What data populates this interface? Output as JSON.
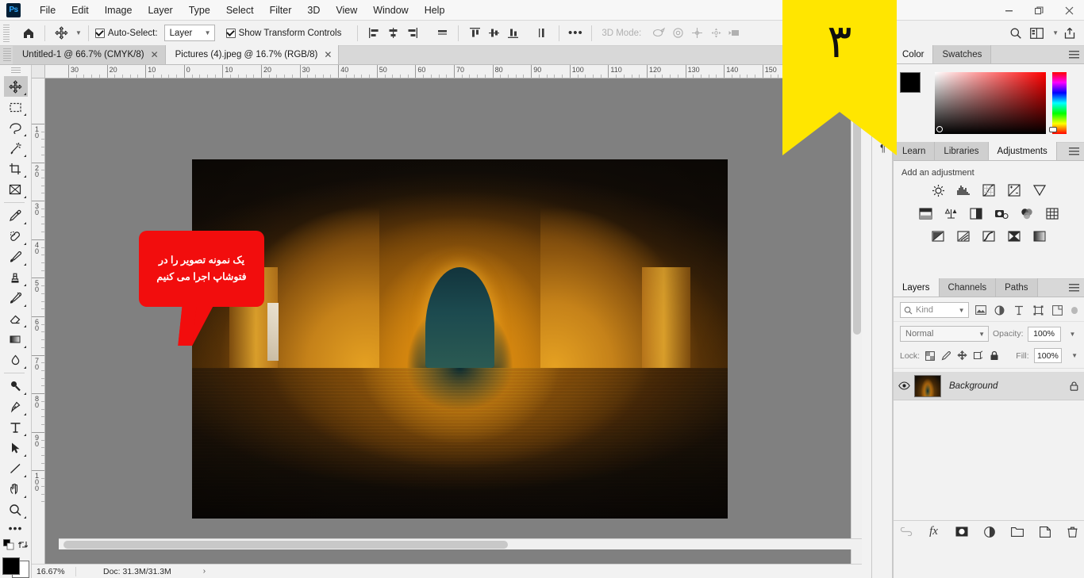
{
  "app": {
    "logo_text": "Ps",
    "menus": [
      "File",
      "Edit",
      "Image",
      "Layer",
      "Type",
      "Select",
      "Filter",
      "3D",
      "View",
      "Window",
      "Help"
    ],
    "window_controls": {
      "minimize": "—",
      "restore": "❐",
      "close": "✕"
    }
  },
  "options_bar": {
    "home_icon": "home-icon",
    "tool_icon": "move-tool-icon",
    "auto_select_label": "Auto-Select:",
    "auto_select_checked": true,
    "auto_select_value": "Layer",
    "show_transform_label": "Show Transform Controls",
    "show_transform_checked": true,
    "more_label": "•••",
    "three_d_mode_label": "3D Mode:",
    "right_icons": [
      "search-icon",
      "workspace-icon",
      "share-icon"
    ]
  },
  "tabs": [
    {
      "title": "Untitled-1 @ 66.7% (CMYK/8)",
      "active": false,
      "close": "✕"
    },
    {
      "title": "Pictures (4).jpeg @ 16.7% (RGB/8)",
      "active": true,
      "close": "✕"
    }
  ],
  "toolbar": {
    "tools": [
      {
        "name": "move-tool",
        "glyph": "move",
        "active": true
      },
      {
        "name": "marquee-tool",
        "glyph": "marquee",
        "active": false
      },
      {
        "name": "lasso-tool",
        "glyph": "lasso",
        "active": false
      },
      {
        "name": "magic-wand-tool",
        "glyph": "wand",
        "active": false
      },
      {
        "name": "crop-tool",
        "glyph": "crop",
        "active": false
      },
      {
        "name": "frame-tool",
        "glyph": "frame",
        "active": false
      },
      {
        "name": "eyedropper-tool",
        "glyph": "eyedropper",
        "active": false
      },
      {
        "name": "healing-brush-tool",
        "glyph": "healing",
        "active": false
      },
      {
        "name": "brush-tool",
        "glyph": "brush",
        "active": false
      },
      {
        "name": "clone-stamp-tool",
        "glyph": "stamp",
        "active": false
      },
      {
        "name": "history-brush-tool",
        "glyph": "history",
        "active": false
      },
      {
        "name": "eraser-tool",
        "glyph": "eraser",
        "active": false
      },
      {
        "name": "gradient-tool",
        "glyph": "gradient",
        "active": false
      },
      {
        "name": "blur-tool",
        "glyph": "blur",
        "active": false
      },
      {
        "name": "dodge-tool",
        "glyph": "dodge",
        "active": false
      },
      {
        "name": "pen-tool",
        "glyph": "pen",
        "active": false
      },
      {
        "name": "type-tool",
        "glyph": "type",
        "active": false
      },
      {
        "name": "path-selection-tool",
        "glyph": "arrow",
        "active": false
      },
      {
        "name": "line-tool",
        "glyph": "line",
        "active": false
      },
      {
        "name": "hand-tool",
        "glyph": "hand",
        "active": false
      },
      {
        "name": "zoom-tool",
        "glyph": "zoom",
        "active": false
      }
    ],
    "more_tools": "•••",
    "foreground_color": "#000000",
    "background_color": "#ffffff"
  },
  "rulers": {
    "horizontal_labels": [
      "30",
      "20",
      "10",
      "0",
      "10",
      "20",
      "30",
      "40",
      "50",
      "60",
      "70",
      "80",
      "90",
      "100",
      "110",
      "120",
      "130",
      "140",
      "150"
    ],
    "vertical_labels": [
      "10",
      "20",
      "30",
      "40",
      "50",
      "60",
      "70",
      "80",
      "90",
      "100"
    ]
  },
  "canvas": {
    "annotation_text": "یک نمونه تصویر را در فتوشاپ اجرا می کنیم",
    "annotation_color": "#f20d0d"
  },
  "ribbon": {
    "number": "۳",
    "color": "#ffe600"
  },
  "status_bar": {
    "zoom": "16.67%",
    "doc": "Doc: 31.3M/31.3M",
    "arrow": "›"
  },
  "icon_strip": {
    "paragraph_icon": "¶"
  },
  "color_panel": {
    "tabs": [
      {
        "label": "Color",
        "active": true
      },
      {
        "label": "Swatches",
        "active": false
      }
    ],
    "foreground": "#000000",
    "background": "#ffffff",
    "field_base_color": "#ff0000"
  },
  "adjustments_panel": {
    "tabs": [
      {
        "label": "Learn",
        "active": false
      },
      {
        "label": "Libraries",
        "active": false
      },
      {
        "label": "Adjustments",
        "active": true
      }
    ],
    "title": "Add an adjustment",
    "rows": [
      [
        "brightness-contrast-icon",
        "levels-icon",
        "curves-icon",
        "exposure-icon",
        "vibrance-icon"
      ],
      [
        "hue-saturation-icon",
        "color-balance-icon",
        "black-white-icon",
        "photo-filter-icon",
        "channel-mixer-icon",
        "color-lookup-icon"
      ],
      [
        "invert-icon",
        "posterize-icon",
        "threshold-icon",
        "selective-color-icon",
        "gradient-map-icon"
      ]
    ]
  },
  "layers_panel": {
    "tabs": [
      {
        "label": "Layers",
        "active": true
      },
      {
        "label": "Channels",
        "active": false
      },
      {
        "label": "Paths",
        "active": false
      }
    ],
    "filter_placeholder": "Kind",
    "filter_icons": [
      "pixel-filter-icon",
      "adjustment-filter-icon",
      "type-filter-icon",
      "shape-filter-icon",
      "smart-object-filter-icon"
    ],
    "blend_mode": "Normal",
    "opacity_label": "Opacity:",
    "opacity_value": "100%",
    "lock_label": "Lock:",
    "lock_icons": [
      "lock-transparent-icon",
      "lock-image-icon",
      "lock-position-icon",
      "lock-artboard-icon",
      "lock-all-icon"
    ],
    "fill_label": "Fill:",
    "fill_value": "100%",
    "layers": [
      {
        "name": "Background",
        "visible": true,
        "locked": true
      }
    ],
    "bottom_icons": [
      "link-layers-icon",
      "layer-style-fx-icon",
      "add-mask-icon",
      "adjustment-layer-icon",
      "new-group-icon",
      "new-layer-icon",
      "delete-layer-icon"
    ]
  }
}
